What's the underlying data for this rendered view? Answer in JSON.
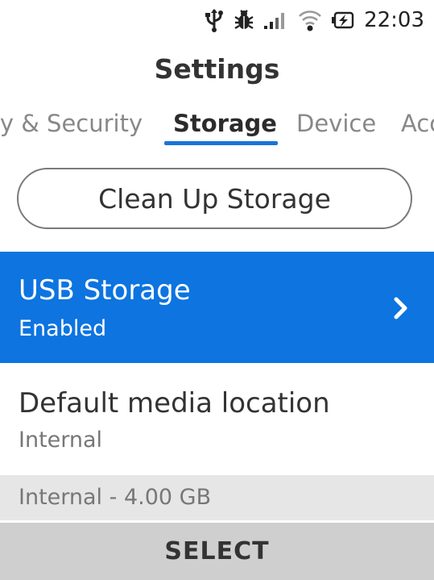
{
  "status_bar": {
    "icons": [
      "usb-icon",
      "bug-icon",
      "signal-icon",
      "wifi-icon",
      "battery-charging-icon"
    ],
    "time": "22:03"
  },
  "header": {
    "title": "Settings"
  },
  "tabs": [
    {
      "label": "Privacy & Security",
      "active": false
    },
    {
      "label": "Storage",
      "active": true
    },
    {
      "label": "Device",
      "active": false
    },
    {
      "label": "Account",
      "active": false
    }
  ],
  "cleanup_button": {
    "label": "Clean Up Storage"
  },
  "items": [
    {
      "title": "USB Storage",
      "subtitle": "Enabled",
      "selected": true
    },
    {
      "title": "Default media location",
      "subtitle": "Internal",
      "selected": false
    }
  ],
  "section": {
    "label": "Internal - 4.00 GB"
  },
  "softkey": {
    "center_label": "SELECT"
  },
  "colors": {
    "accent": "#0d74e0",
    "tab_underline": "#1a73d9",
    "softkey_bg": "#cfcfcf",
    "section_bg": "#e6e6e6"
  }
}
